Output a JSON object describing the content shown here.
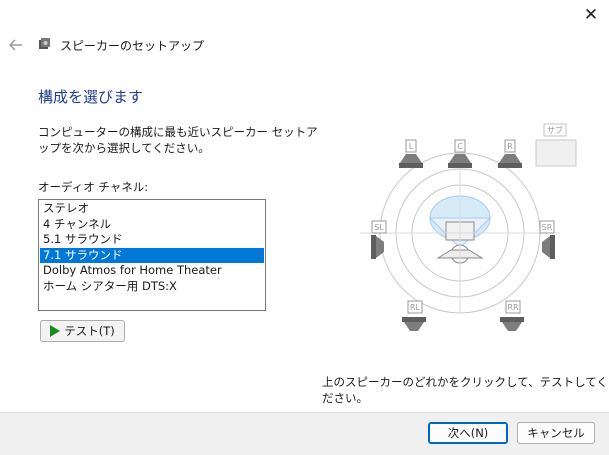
{
  "window": {
    "title": "スピーカーのセットアップ",
    "close_glyph": "✕"
  },
  "page": {
    "heading": "構成を選びます",
    "description": "コンピューターの構成に最も近いスピーカー セットアップを次から選択してください。",
    "audio_channel_label": "オーディオ チャネル:"
  },
  "channel_list": {
    "items": [
      {
        "label": "ステレオ"
      },
      {
        "label": "4 チャンネル"
      },
      {
        "label": "5.1 サラウンド"
      },
      {
        "label": "7.1 サラウンド",
        "selected": true
      },
      {
        "label": "Dolby Atmos for Home Theater"
      },
      {
        "label": "ホーム シアター用 DTS:X"
      }
    ]
  },
  "test_button": {
    "label": "テスト(T)"
  },
  "speaker_diagram": {
    "labels": {
      "L": "L",
      "C": "C",
      "R": "R",
      "SL": "SL",
      "SR": "SR",
      "RL": "RL",
      "RR": "RR",
      "SUB": "サブ"
    }
  },
  "hint": "上のスピーカーのどれかをクリックして、テストしてください。",
  "footer": {
    "next_label": "次へ(N)",
    "cancel_label": "キャンセル"
  },
  "colors": {
    "accent": "#0078d7",
    "heading": "#1f3f8f",
    "play": "#1a8a1a"
  }
}
